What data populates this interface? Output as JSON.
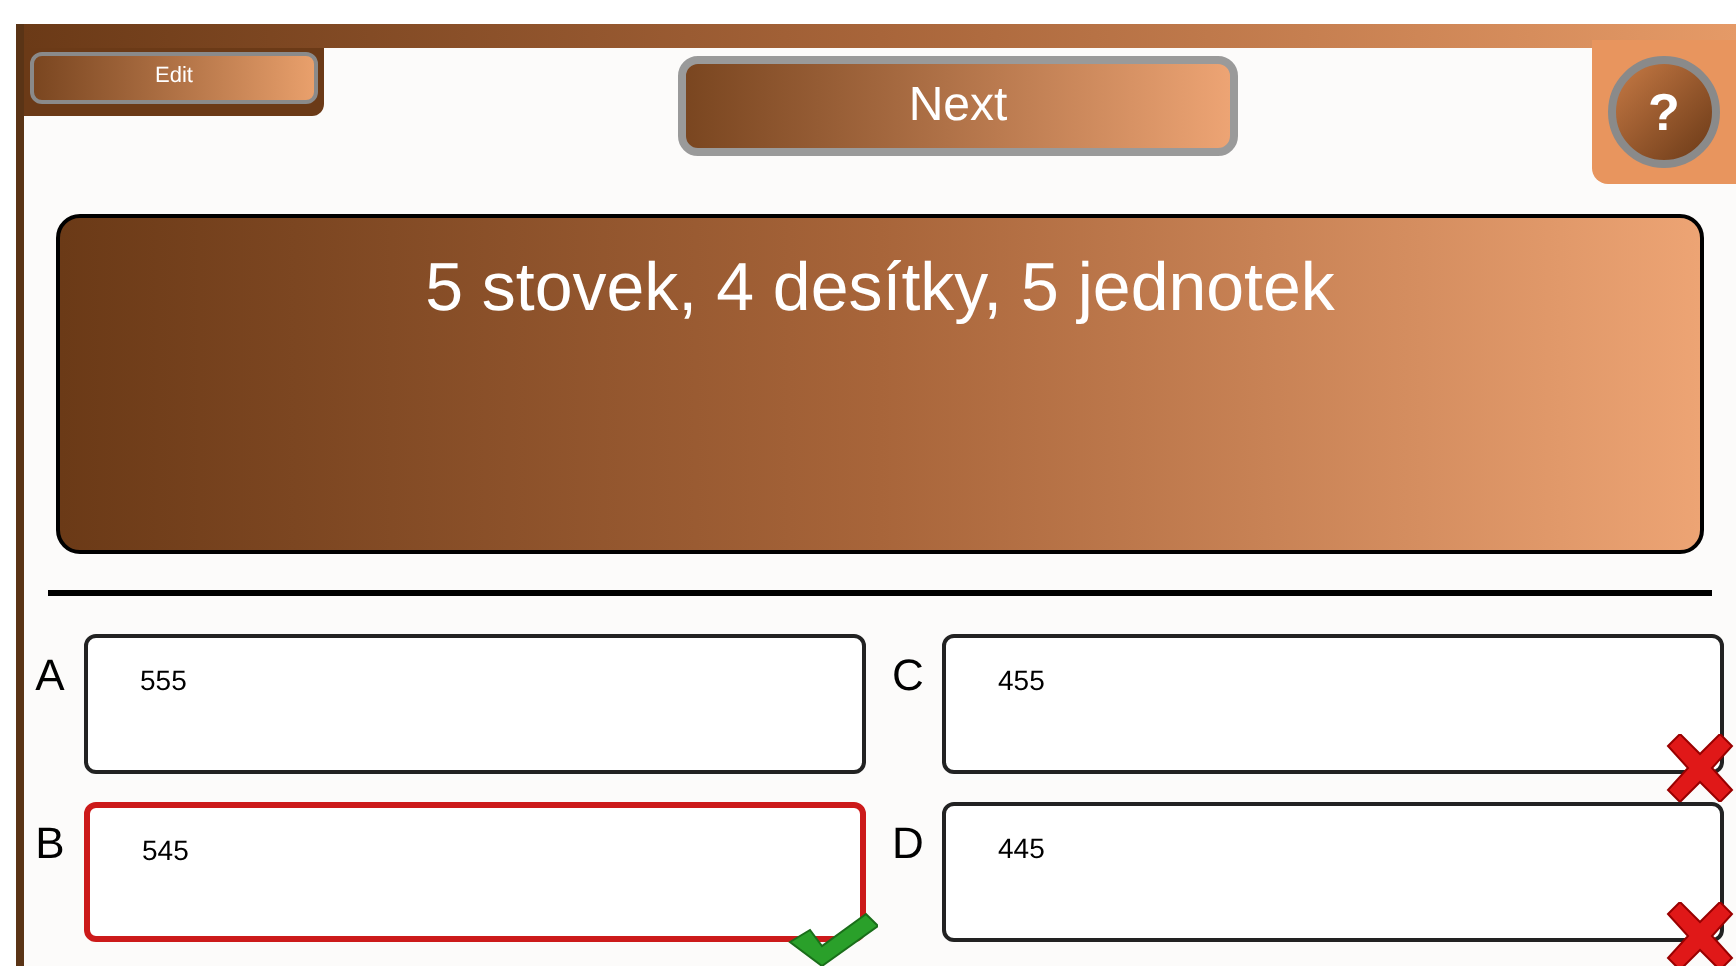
{
  "toolbar": {
    "edit_button": "Edit",
    "next_button": "Next",
    "help_button": "?"
  },
  "question": "5 stovek, 4 desítky, 5 jednotek",
  "answers": [
    {
      "letter": "A",
      "text": "555",
      "selected": false,
      "kind": "plain"
    },
    {
      "letter": "C",
      "text": "455",
      "selected": false,
      "kind": "wrong"
    },
    {
      "letter": "B",
      "text": "545",
      "selected": true,
      "kind": "correct"
    },
    {
      "letter": "D",
      "text": "445",
      "selected": false,
      "kind": "wrong"
    }
  ]
}
